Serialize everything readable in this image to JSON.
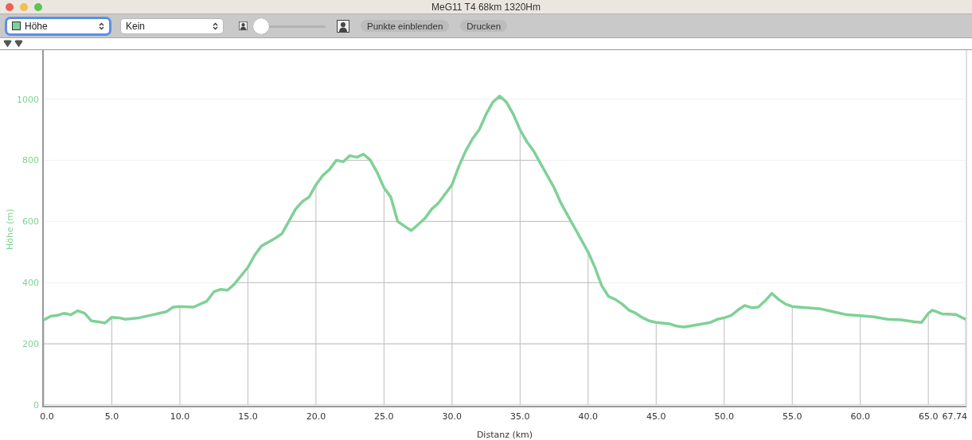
{
  "window": {
    "title": "MeG11 T4 68km 1320Hm"
  },
  "toolbar": {
    "primary_select": {
      "value": "Höhe",
      "color": "#7fd196",
      "focused": true
    },
    "secondary_select": {
      "value": "Kein",
      "focused": false
    },
    "zoom_slider": {
      "level": 0.04
    },
    "buttons": [
      "Punkte einblenden",
      "Drucken"
    ]
  },
  "chart": {
    "chart_data": {
      "type": "line",
      "xlabel": "Distanz (km)",
      "ylabel": "Höhe (m)",
      "x": [
        0,
        0.5,
        1,
        1.5,
        2,
        2.5,
        3,
        3.5,
        4,
        4.5,
        5,
        5.5,
        6,
        7,
        8,
        9,
        9.5,
        10,
        11,
        12,
        12.5,
        13,
        13.5,
        14,
        15,
        15.5,
        16,
        17,
        17.5,
        18,
        18.5,
        19,
        19.5,
        20,
        20.5,
        21,
        21.5,
        22,
        22.5,
        23,
        23.5,
        24,
        24.5,
        25,
        25.5,
        26,
        26.5,
        27,
        27.5,
        28,
        28.5,
        29,
        29.5,
        30,
        30.5,
        31,
        31.5,
        32,
        32.5,
        33,
        33.5,
        34,
        34.5,
        35,
        35.5,
        36,
        36.5,
        37,
        37.5,
        38,
        38.5,
        39,
        39.5,
        40,
        40.5,
        41,
        41.5,
        42,
        42.5,
        43,
        43.5,
        44,
        44.5,
        45,
        46,
        46.5,
        47,
        47.5,
        48,
        49,
        49.5,
        50,
        50.5,
        51,
        51.5,
        52,
        52.5,
        53,
        53.5,
        54,
        54.5,
        55,
        56,
        57,
        58,
        59,
        60,
        61,
        62,
        63,
        64,
        64.5,
        65,
        65.3,
        66,
        67,
        67.74
      ],
      "grid": true,
      "series": [
        {
          "color": "#7fd196",
          "values": [
            278,
            290,
            293,
            300,
            295,
            308,
            300,
            275,
            272,
            268,
            287,
            285,
            280,
            285,
            295,
            305,
            320,
            322,
            320,
            340,
            370,
            378,
            375,
            395,
            450,
            490,
            520,
            545,
            560,
            600,
            640,
            665,
            680,
            720,
            750,
            770,
            800,
            795,
            815,
            810,
            820,
            800,
            760,
            710,
            680,
            600,
            585,
            570,
            590,
            610,
            640,
            660,
            690,
            720,
            780,
            830,
            870,
            900,
            950,
            990,
            1010,
            990,
            950,
            900,
            860,
            830,
            790,
            750,
            710,
            660,
            620,
            580,
            540,
            500,
            450,
            390,
            355,
            345,
            330,
            310,
            300,
            285,
            275,
            270,
            265,
            258,
            255,
            258,
            262,
            270,
            280,
            285,
            292,
            310,
            325,
            318,
            320,
            340,
            365,
            345,
            330,
            322,
            318,
            315,
            305,
            295,
            292,
            288,
            280,
            278,
            272,
            270,
            300,
            310,
            298,
            296,
            280
          ]
        }
      ],
      "xlim": [
        0,
        67.74
      ],
      "ylim": [
        0,
        1160
      ],
      "xticks": [
        {
          "value": 0,
          "label": "0.0"
        },
        {
          "value": 5,
          "label": "5.0"
        },
        {
          "value": 10,
          "label": "10.0"
        },
        {
          "value": 15,
          "label": "15.0"
        },
        {
          "value": 20,
          "label": "20.0"
        },
        {
          "value": 25,
          "label": "25.0"
        },
        {
          "value": 30,
          "label": "30.0"
        },
        {
          "value": 35,
          "label": "35.0"
        },
        {
          "value": 40,
          "label": "40.0"
        },
        {
          "value": 45,
          "label": "45.0"
        },
        {
          "value": 50,
          "label": "50.0"
        },
        {
          "value": 55,
          "label": "55.0"
        },
        {
          "value": 60,
          "label": "60.0"
        },
        {
          "value": 65,
          "label": "65.0"
        },
        {
          "value": 67.74,
          "label": "67.74"
        }
      ],
      "yticks": [
        0,
        200,
        400,
        600,
        800,
        1000
      ]
    }
  }
}
